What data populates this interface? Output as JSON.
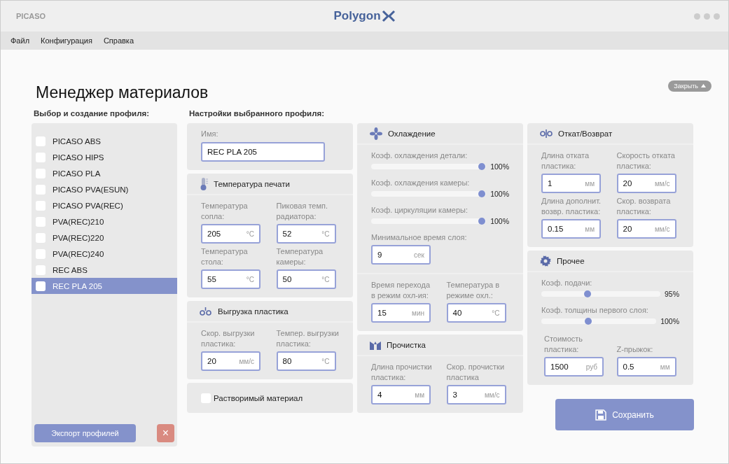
{
  "window": {
    "title": "PICASO",
    "logo": "Polygon"
  },
  "menu": [
    "Файл",
    "Конфигурация",
    "Справка"
  ],
  "page": {
    "title": "Менеджер материалов",
    "close_button": "Закрыть"
  },
  "profiles": {
    "heading": "Выбор и создание профиля:",
    "items": [
      {
        "label": "PICASO ABS",
        "checked": false,
        "selected": false
      },
      {
        "label": "PICASO HIPS",
        "checked": false,
        "selected": false
      },
      {
        "label": "PICASO PLA",
        "checked": false,
        "selected": false
      },
      {
        "label": "PICASO PVA(ESUN)",
        "checked": false,
        "selected": false
      },
      {
        "label": "PICASO PVA(REC)",
        "checked": false,
        "selected": false
      },
      {
        "label": " PVA(REC)210",
        "checked": false,
        "selected": false
      },
      {
        "label": " PVA(REC)220",
        "checked": false,
        "selected": false
      },
      {
        "label": " PVA(REC)240",
        "checked": false,
        "selected": false
      },
      {
        "label": "REC ABS",
        "checked": false,
        "selected": false
      },
      {
        "label": "REC PLA 205",
        "checked": false,
        "selected": true
      }
    ],
    "export_button": "Экспорт профилей",
    "delete_button": "×"
  },
  "settings": {
    "heading": "Настройки выбранного профиля:",
    "name": {
      "label": "Имя:",
      "value": "REC PLA 205"
    },
    "print_temperature": {
      "title": "Температура печати",
      "fields": [
        {
          "label": "Температура сопла:",
          "value": "205",
          "unit": "°C"
        },
        {
          "label": "Пиковая темп. радиатора:",
          "value": "52",
          "unit": "°C"
        },
        {
          "label": "Температура стола:",
          "value": "55",
          "unit": "°C"
        },
        {
          "label": "Температура камеры:",
          "value": "50",
          "unit": "°C"
        }
      ]
    },
    "unload": {
      "title": "Выгрузка пластика",
      "fields": [
        {
          "label": "Скор. выгрузки пластика:",
          "value": "20",
          "unit": "мм/с"
        },
        {
          "label": "Темпер. выгрузки пластика:",
          "value": "80",
          "unit": "°C"
        }
      ]
    },
    "soluble": {
      "label": "Растворимый материал",
      "checked": false
    },
    "cooling": {
      "title": "Охлаждение",
      "sliders": [
        {
          "label": "Коэф. охлаждения детали:",
          "level": 0.99,
          "reading": "100%"
        },
        {
          "label": "Коэф. охлаждения камеры:",
          "level": 0.99,
          "reading": "100%"
        },
        {
          "label": "Коэф. циркуляции камеры:",
          "level": 0.99,
          "reading": "100%"
        }
      ],
      "fields": [
        {
          "label": "Минимальное время слоя:",
          "value": "9",
          "unit": "сек"
        }
      ],
      "transition_fields": [
        {
          "label": "Время перехода в режим охл-ия:",
          "value": "15",
          "unit": "мин"
        },
        {
          "label": "Температура в режиме охл.:",
          "value": "40",
          "unit": "°C"
        }
      ]
    },
    "purge": {
      "title": "Прочистка",
      "fields": [
        {
          "label": "Длина прочистки пластика:",
          "value": "4",
          "unit": "мм"
        },
        {
          "label": "Скор. прочистки пластика",
          "value": "3",
          "unit": "мм/с"
        }
      ]
    },
    "retraction": {
      "title": "Откат/Возврат",
      "fields": [
        {
          "label": "Длина отката пластика:",
          "value": "1",
          "unit": "мм"
        },
        {
          "label": "Скорость отката пластика:",
          "value": "20",
          "unit": "мм/с"
        },
        {
          "label": "Длина дополнит. возвр. пластика:",
          "value": "0.15",
          "unit": "мм"
        },
        {
          "label": "Скор. возврата пластика:",
          "value": "20",
          "unit": "мм/с"
        }
      ]
    },
    "other": {
      "title": "Прочее",
      "sliders": [
        {
          "label": "Коэф. подачи:",
          "level": 0.38,
          "reading": "95%"
        },
        {
          "label": "Коэф. толщины первого слоя:",
          "level": 0.4,
          "reading": "100%"
        }
      ],
      "fields": [
        {
          "label": "Стоимость пластика:",
          "value": "1500",
          "unit": "руб"
        },
        {
          "label": "Z-прыжок:",
          "value": "0.5",
          "unit": "мм"
        }
      ]
    },
    "save_button": "Сохранить"
  }
}
